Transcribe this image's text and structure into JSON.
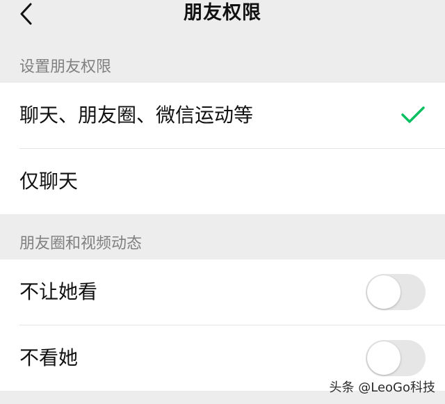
{
  "nav": {
    "title": "朋友权限"
  },
  "sections": [
    {
      "header": "设置朋友权限",
      "items": [
        {
          "label": "聊天、朋友圈、微信运动等",
          "selected": true
        },
        {
          "label": "仅聊天",
          "selected": false
        }
      ]
    },
    {
      "header": "朋友圈和视频动态",
      "items": [
        {
          "label": "不让她看",
          "toggle_on": false
        },
        {
          "label": "不看她",
          "toggle_on": false
        }
      ]
    }
  ],
  "colors": {
    "accent": "#07c160",
    "background": "#ededed",
    "card": "#ffffff",
    "toggle_off": "#e6e6e6"
  },
  "watermark": "头条 @LeoGo科技"
}
